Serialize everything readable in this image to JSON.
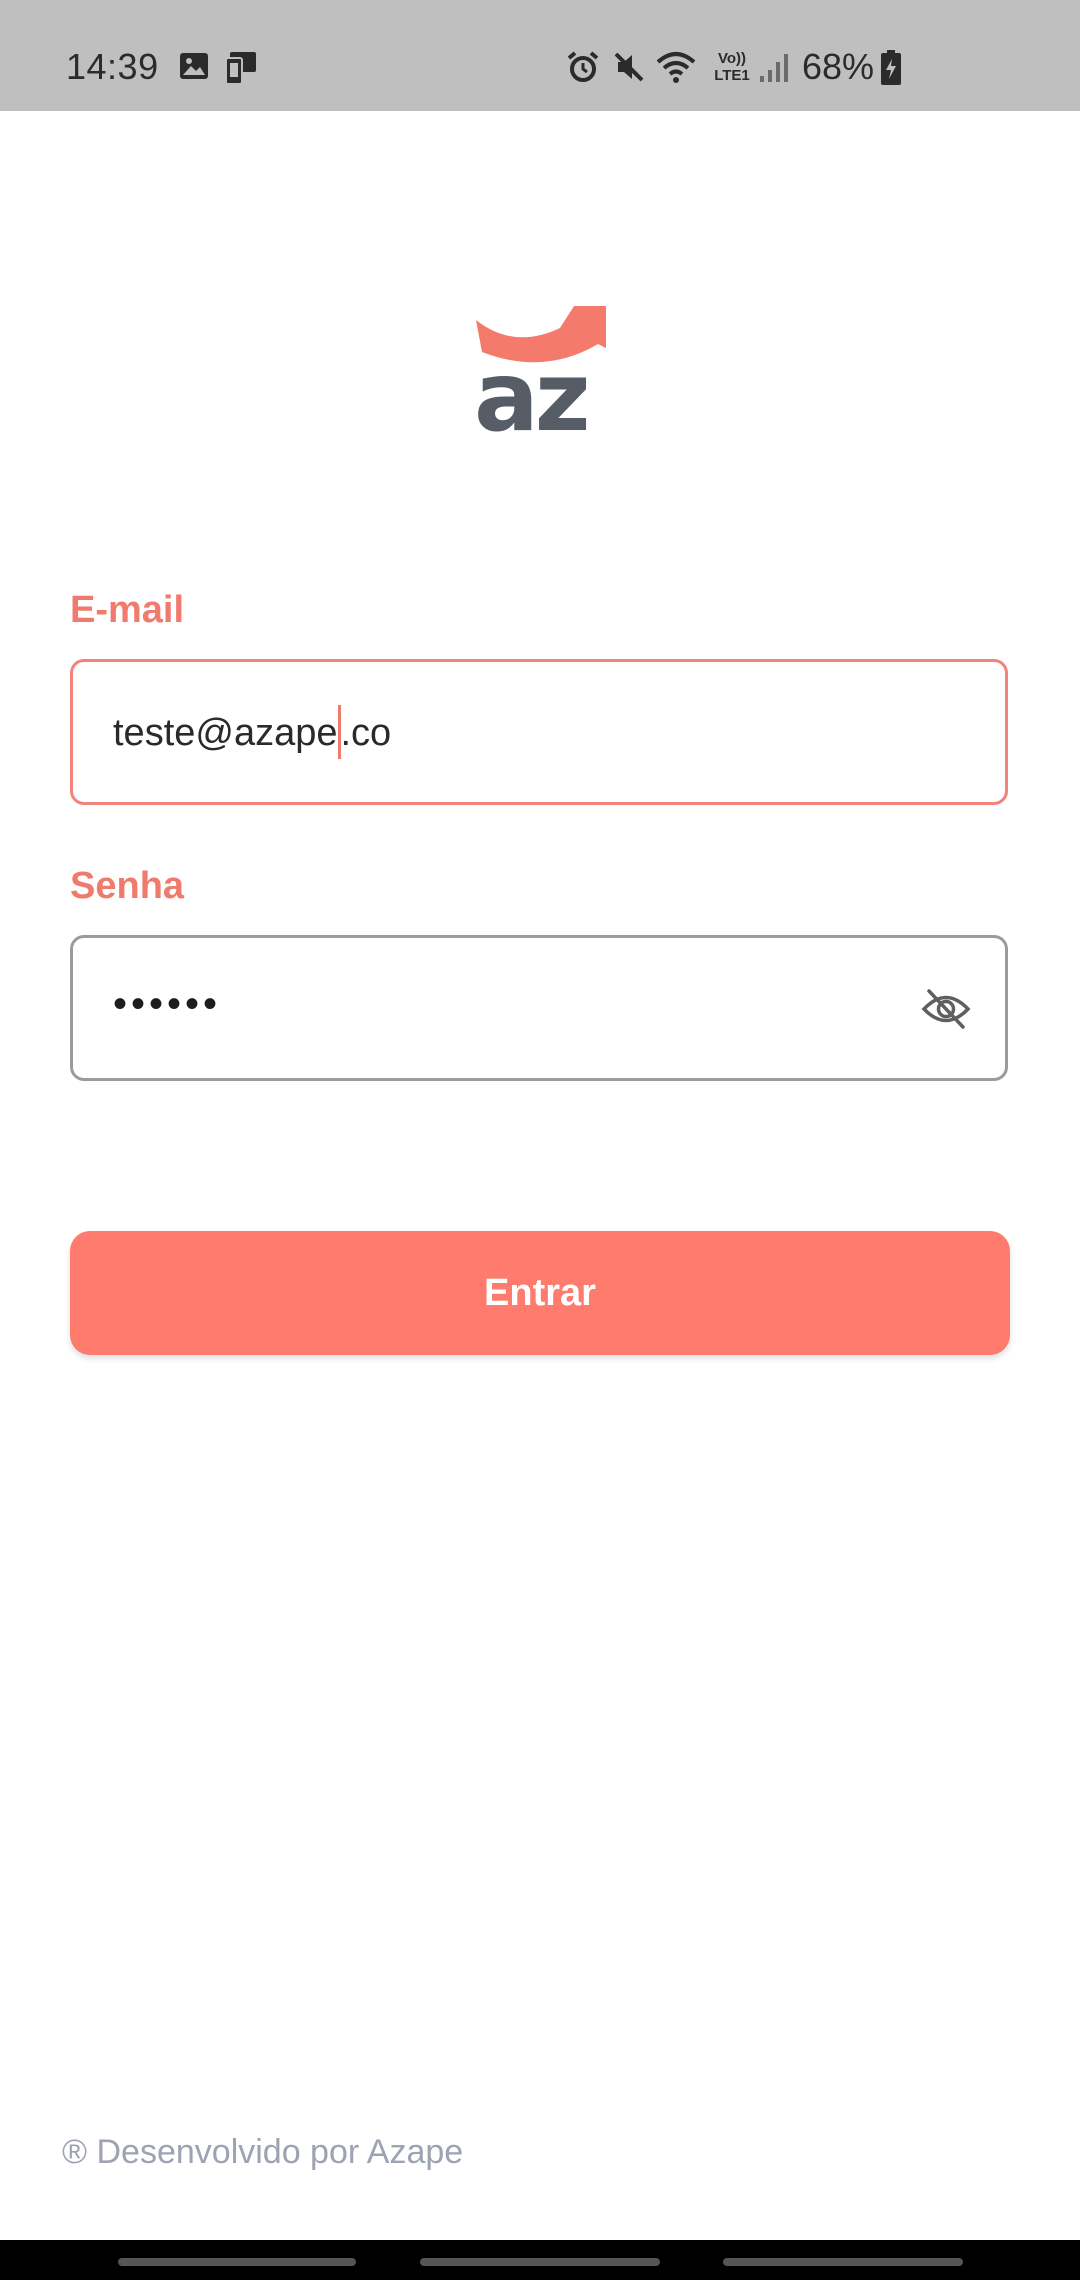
{
  "status_bar": {
    "time": "14:39",
    "battery_percent": "68%",
    "network_label_top": "Vo))",
    "network_label_bottom": "LTE1",
    "left_icons": [
      "image-icon",
      "device-icon"
    ],
    "right_icons": [
      "alarm-icon",
      "mute-icon",
      "wifi-icon",
      "volte-icon",
      "signal-icon",
      "battery-charging-icon"
    ]
  },
  "logo": {
    "text": "az",
    "colors": {
      "arc": "#f47a6b",
      "letters": "#565d66"
    }
  },
  "form": {
    "email_label": "E-mail",
    "email_value_before_caret": "teste@azape",
    "email_value_after_caret": ".co",
    "password_label": "Senha",
    "password_value": "••••••",
    "toggle_icon": "eye-off-icon"
  },
  "button": {
    "label": "Entrar"
  },
  "footer": {
    "text": "® Desenvolvido por Azape"
  },
  "colors": {
    "accent": "#ff7b6e",
    "label": "#f07a6c",
    "status_bar_bg": "#bfbfbf",
    "footer_text": "#9ea3b3"
  }
}
